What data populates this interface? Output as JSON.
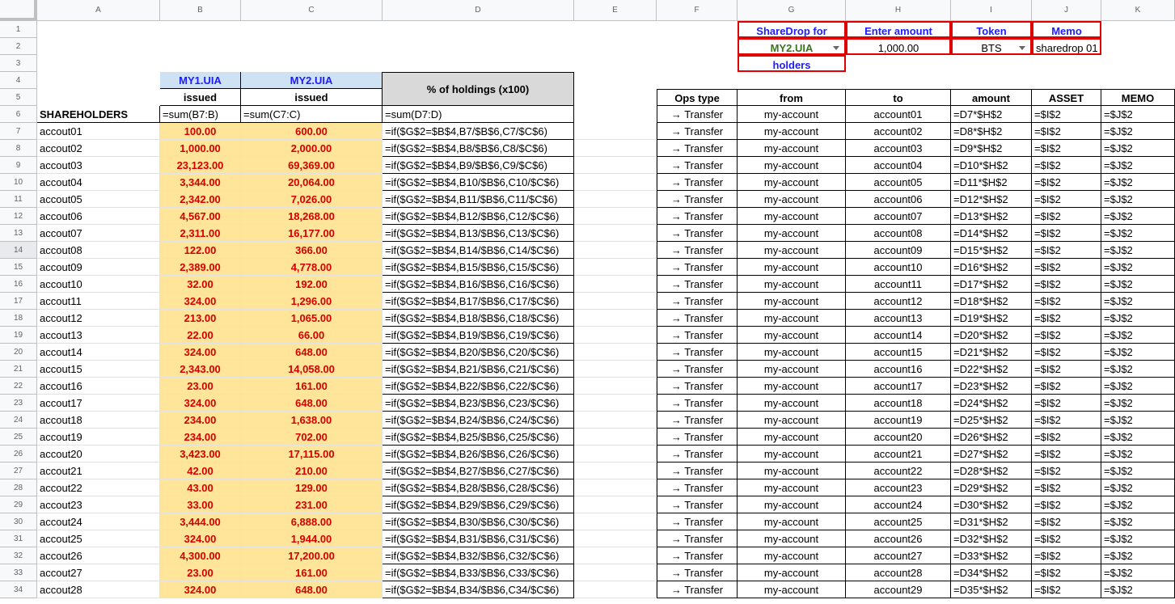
{
  "columns": [
    "A",
    "B",
    "C",
    "D",
    "E",
    "F",
    "G",
    "H",
    "I",
    "J",
    "K"
  ],
  "rows": [
    "1",
    "2",
    "3",
    "4",
    "5",
    "6",
    "7",
    "8",
    "9",
    "10",
    "11",
    "12",
    "13",
    "14",
    "15",
    "16",
    "17",
    "18",
    "19",
    "20",
    "21",
    "22",
    "23",
    "24",
    "25",
    "26",
    "27",
    "28",
    "29",
    "30",
    "31",
    "32",
    "33",
    "34"
  ],
  "controls": {
    "sharedrop_label": "ShareDrop for",
    "sharedrop_value": "MY2.UIA",
    "holders_label": "holders",
    "amount_label": "Enter amount",
    "amount_value": "1,000.00",
    "token_label": "Token",
    "token_value": "BTS",
    "memo_label": "Memo",
    "memo_value": "sharedrop 01"
  },
  "left_table": {
    "asset1": "MY1.UIA",
    "asset2": "MY2.UIA",
    "issued1": "issued",
    "issued2": "issued",
    "pct_header": "% of holdings (x100)",
    "shareholders_header": "SHAREHOLDERS",
    "sum_b": "=sum(B7:B)",
    "sum_c": "=sum(C7:C)",
    "sum_d": "=sum(D7:D)",
    "rows": [
      {
        "name": "accout01",
        "b": "100.00",
        "c": "600.00",
        "d": "=if($G$2=$B$4,B7/$B$6,C7/$C$6)"
      },
      {
        "name": "accout02",
        "b": "1,000.00",
        "c": "2,000.00",
        "d": "=if($G$2=$B$4,B8/$B$6,C8/$C$6)"
      },
      {
        "name": "accout03",
        "b": "23,123.00",
        "c": "69,369.00",
        "d": "=if($G$2=$B$4,B9/$B$6,C9/$C$6)"
      },
      {
        "name": "accout04",
        "b": "3,344.00",
        "c": "20,064.00",
        "d": "=if($G$2=$B$4,B10/$B$6,C10/$C$6)"
      },
      {
        "name": "accout05",
        "b": "2,342.00",
        "c": "7,026.00",
        "d": "=if($G$2=$B$4,B11/$B$6,C11/$C$6)"
      },
      {
        "name": "accout06",
        "b": "4,567.00",
        "c": "18,268.00",
        "d": "=if($G$2=$B$4,B12/$B$6,C12/$C$6)"
      },
      {
        "name": "accout07",
        "b": "2,311.00",
        "c": "16,177.00",
        "d": "=if($G$2=$B$4,B13/$B$6,C13/$C$6)"
      },
      {
        "name": "accout08",
        "b": "122.00",
        "c": "366.00",
        "d": "=if($G$2=$B$4,B14/$B$6,C14/$C$6)"
      },
      {
        "name": "accout09",
        "b": "2,389.00",
        "c": "4,778.00",
        "d": "=if($G$2=$B$4,B15/$B$6,C15/$C$6)"
      },
      {
        "name": "accout10",
        "b": "32.00",
        "c": "192.00",
        "d": "=if($G$2=$B$4,B16/$B$6,C16/$C$6)"
      },
      {
        "name": "accout11",
        "b": "324.00",
        "c": "1,296.00",
        "d": "=if($G$2=$B$4,B17/$B$6,C17/$C$6)"
      },
      {
        "name": "accout12",
        "b": "213.00",
        "c": "1,065.00",
        "d": "=if($G$2=$B$4,B18/$B$6,C18/$C$6)"
      },
      {
        "name": "accout13",
        "b": "22.00",
        "c": "66.00",
        "d": "=if($G$2=$B$4,B19/$B$6,C19/$C$6)"
      },
      {
        "name": "accout14",
        "b": "324.00",
        "c": "648.00",
        "d": "=if($G$2=$B$4,B20/$B$6,C20/$C$6)"
      },
      {
        "name": "accout15",
        "b": "2,343.00",
        "c": "14,058.00",
        "d": "=if($G$2=$B$4,B21/$B$6,C21/$C$6)"
      },
      {
        "name": "accout16",
        "b": "23.00",
        "c": "161.00",
        "d": "=if($G$2=$B$4,B22/$B$6,C22/$C$6)"
      },
      {
        "name": "accout17",
        "b": "324.00",
        "c": "648.00",
        "d": "=if($G$2=$B$4,B23/$B$6,C23/$C$6)"
      },
      {
        "name": "accout18",
        "b": "234.00",
        "c": "1,638.00",
        "d": "=if($G$2=$B$4,B24/$B$6,C24/$C$6)"
      },
      {
        "name": "accout19",
        "b": "234.00",
        "c": "702.00",
        "d": "=if($G$2=$B$4,B25/$B$6,C25/$C$6)"
      },
      {
        "name": "accout20",
        "b": "3,423.00",
        "c": "17,115.00",
        "d": "=if($G$2=$B$4,B26/$B$6,C26/$C$6)"
      },
      {
        "name": "accout21",
        "b": "42.00",
        "c": "210.00",
        "d": "=if($G$2=$B$4,B27/$B$6,C27/$C$6)"
      },
      {
        "name": "accout22",
        "b": "43.00",
        "c": "129.00",
        "d": "=if($G$2=$B$4,B28/$B$6,C28/$C$6)"
      },
      {
        "name": "accout23",
        "b": "33.00",
        "c": "231.00",
        "d": "=if($G$2=$B$4,B29/$B$6,C29/$C$6)"
      },
      {
        "name": "accout24",
        "b": "3,444.00",
        "c": "6,888.00",
        "d": "=if($G$2=$B$4,B30/$B$6,C30/$C$6)"
      },
      {
        "name": "accout25",
        "b": "324.00",
        "c": "1,944.00",
        "d": "=if($G$2=$B$4,B31/$B$6,C31/$C$6)"
      },
      {
        "name": "accout26",
        "b": "4,300.00",
        "c": "17,200.00",
        "d": "=if($G$2=$B$4,B32/$B$6,C32/$C$6)"
      },
      {
        "name": "accout27",
        "b": "23.00",
        "c": "161.00",
        "d": "=if($G$2=$B$4,B33/$B$6,C33/$C$6)"
      },
      {
        "name": "accout28",
        "b": "324.00",
        "c": "648.00",
        "d": "=if($G$2=$B$4,B34/$B$6,C34/$C$6)"
      }
    ]
  },
  "right_table": {
    "headers": {
      "ops": "Ops type",
      "from": "from",
      "to": "to",
      "amount": "amount",
      "asset": "ASSET",
      "memo": "MEMO"
    },
    "rows": [
      {
        "ops": "→ Transfer",
        "from": "my-account",
        "to": "account01",
        "amount": "=D7*$H$2",
        "asset": "=$I$2",
        "memo": "=$J$2"
      },
      {
        "ops": "→ Transfer",
        "from": "my-account",
        "to": "account02",
        "amount": "=D8*$H$2",
        "asset": "=$I$2",
        "memo": "=$J$2"
      },
      {
        "ops": "→ Transfer",
        "from": "my-account",
        "to": "account03",
        "amount": "=D9*$H$2",
        "asset": "=$I$2",
        "memo": "=$J$2"
      },
      {
        "ops": "→ Transfer",
        "from": "my-account",
        "to": "account04",
        "amount": "=D10*$H$2",
        "asset": "=$I$2",
        "memo": "=$J$2"
      },
      {
        "ops": "→ Transfer",
        "from": "my-account",
        "to": "account05",
        "amount": "=D11*$H$2",
        "asset": "=$I$2",
        "memo": "=$J$2"
      },
      {
        "ops": "→ Transfer",
        "from": "my-account",
        "to": "account06",
        "amount": "=D12*$H$2",
        "asset": "=$I$2",
        "memo": "=$J$2"
      },
      {
        "ops": "→ Transfer",
        "from": "my-account",
        "to": "account07",
        "amount": "=D13*$H$2",
        "asset": "=$I$2",
        "memo": "=$J$2"
      },
      {
        "ops": "→ Transfer",
        "from": "my-account",
        "to": "account08",
        "amount": "=D14*$H$2",
        "asset": "=$I$2",
        "memo": "=$J$2"
      },
      {
        "ops": "→ Transfer",
        "from": "my-account",
        "to": "account09",
        "amount": "=D15*$H$2",
        "asset": "=$I$2",
        "memo": "=$J$2"
      },
      {
        "ops": "→ Transfer",
        "from": "my-account",
        "to": "account10",
        "amount": "=D16*$H$2",
        "asset": "=$I$2",
        "memo": "=$J$2"
      },
      {
        "ops": "→ Transfer",
        "from": "my-account",
        "to": "account11",
        "amount": "=D17*$H$2",
        "asset": "=$I$2",
        "memo": "=$J$2"
      },
      {
        "ops": "→ Transfer",
        "from": "my-account",
        "to": "account12",
        "amount": "=D18*$H$2",
        "asset": "=$I$2",
        "memo": "=$J$2"
      },
      {
        "ops": "→ Transfer",
        "from": "my-account",
        "to": "account13",
        "amount": "=D19*$H$2",
        "asset": "=$I$2",
        "memo": "=$J$2"
      },
      {
        "ops": "→ Transfer",
        "from": "my-account",
        "to": "account14",
        "amount": "=D20*$H$2",
        "asset": "=$I$2",
        "memo": "=$J$2"
      },
      {
        "ops": "→ Transfer",
        "from": "my-account",
        "to": "account15",
        "amount": "=D21*$H$2",
        "asset": "=$I$2",
        "memo": "=$J$2"
      },
      {
        "ops": "→ Transfer",
        "from": "my-account",
        "to": "account16",
        "amount": "=D22*$H$2",
        "asset": "=$I$2",
        "memo": "=$J$2"
      },
      {
        "ops": "→ Transfer",
        "from": "my-account",
        "to": "account17",
        "amount": "=D23*$H$2",
        "asset": "=$I$2",
        "memo": "=$J$2"
      },
      {
        "ops": "→ Transfer",
        "from": "my-account",
        "to": "account18",
        "amount": "=D24*$H$2",
        "asset": "=$I$2",
        "memo": "=$J$2"
      },
      {
        "ops": "→ Transfer",
        "from": "my-account",
        "to": "account19",
        "amount": "=D25*$H$2",
        "asset": "=$I$2",
        "memo": "=$J$2"
      },
      {
        "ops": "→ Transfer",
        "from": "my-account",
        "to": "account20",
        "amount": "=D26*$H$2",
        "asset": "=$I$2",
        "memo": "=$J$2"
      },
      {
        "ops": "→ Transfer",
        "from": "my-account",
        "to": "account21",
        "amount": "=D27*$H$2",
        "asset": "=$I$2",
        "memo": "=$J$2"
      },
      {
        "ops": "→ Transfer",
        "from": "my-account",
        "to": "account22",
        "amount": "=D28*$H$2",
        "asset": "=$I$2",
        "memo": "=$J$2"
      },
      {
        "ops": "→ Transfer",
        "from": "my-account",
        "to": "account23",
        "amount": "=D29*$H$2",
        "asset": "=$I$2",
        "memo": "=$J$2"
      },
      {
        "ops": "→ Transfer",
        "from": "my-account",
        "to": "account24",
        "amount": "=D30*$H$2",
        "asset": "=$I$2",
        "memo": "=$J$2"
      },
      {
        "ops": "→ Transfer",
        "from": "my-account",
        "to": "account25",
        "amount": "=D31*$H$2",
        "asset": "=$I$2",
        "memo": "=$J$2"
      },
      {
        "ops": "→ Transfer",
        "from": "my-account",
        "to": "account26",
        "amount": "=D32*$H$2",
        "asset": "=$I$2",
        "memo": "=$J$2"
      },
      {
        "ops": "→ Transfer",
        "from": "my-account",
        "to": "account27",
        "amount": "=D33*$H$2",
        "asset": "=$I$2",
        "memo": "=$J$2"
      },
      {
        "ops": "→ Transfer",
        "from": "my-account",
        "to": "account28",
        "amount": "=D34*$H$2",
        "asset": "=$I$2",
        "memo": "=$J$2"
      },
      {
        "ops": "→ Transfer",
        "from": "my-account",
        "to": "account29",
        "amount": "=D35*$H$2",
        "asset": "=$I$2",
        "memo": "=$J$2"
      }
    ]
  }
}
